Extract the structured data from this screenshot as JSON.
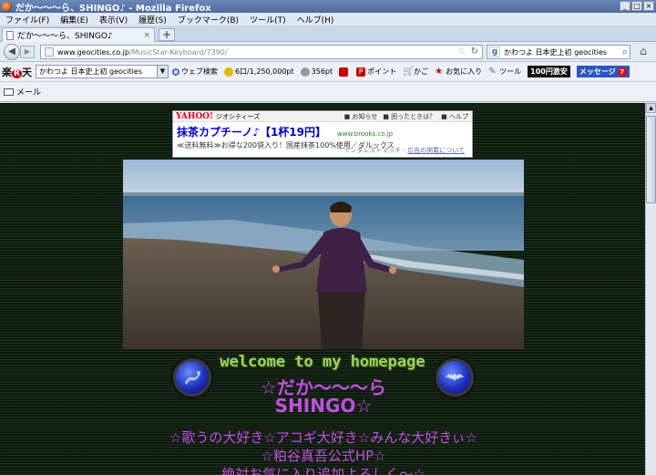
{
  "window": {
    "title": "だか～～～ら、SHINGO♪ - Mozilla Firefox",
    "controls": [
      "_",
      "□",
      "×"
    ]
  },
  "menu": [
    "ファイル(F)",
    "編集(E)",
    "表示(V)",
    "履歴(S)",
    "ブックマーク(B)",
    "ツール(T)",
    "ヘルプ(H)"
  ],
  "tab": {
    "label": "だか～～～ら、SHINGO♪",
    "close": "×",
    "new": "+"
  },
  "nav": {
    "back": "◀",
    "forward": "▶",
    "url_host": "www.geocities.co.jp",
    "url_path": "/MusicStar-Keyboard/7390/",
    "search_value": "かわつよ 日本史上初 geocities",
    "search_engine_icon": "google-g-icon",
    "home": "⌂"
  },
  "rakuten_bar": {
    "logo_text": "楽",
    "logo_r": "R",
    "logo_text2": "天",
    "search_value": "かわつよ 日本史上初 geocities",
    "items": [
      {
        "label": "ウェブ検索",
        "icon": "magnifier-icon"
      },
      {
        "label": "6口/1,250,000pt",
        "icon": "coin-icon"
      },
      {
        "label": "356pt",
        "icon": "points-icon"
      },
      {
        "label": "",
        "icon": "rakuten-card-icon"
      },
      {
        "label": "ポイント",
        "icon": "p-icon"
      },
      {
        "label": "かご",
        "icon": "cart-icon"
      },
      {
        "label": "お気に入り",
        "icon": "star-icon"
      },
      {
        "label": "ツール",
        "icon": "wrench-icon"
      }
    ],
    "sale_badge": "100円激安",
    "message_badge": "メッセージ",
    "message_count": "7"
  },
  "mail_bar": {
    "label": "メール"
  },
  "ad": {
    "brand": "YAHOO!",
    "brand_sub": "ジオシティーズ",
    "links": [
      "■ お知らせ",
      "■ 困ったときは？",
      "■ ヘルプ"
    ],
    "title": "抹茶カプチーノ♪【1杯19円】",
    "domain": "www.brooks.co.jp",
    "text": "≪送料無料≫お得な200袋入り！国産抹茶100%使用／ダルックス",
    "footer_prefix": "インタレストマッチ - ",
    "footer_link": "広告の掲載について"
  },
  "page": {
    "welcome": "welcome to my homepage",
    "name_line1": "☆だか～～～ら",
    "name_line2": "SHINGO☆",
    "line1": "☆歌うの大好き☆アコギ大好き☆みんな大好きぃ☆",
    "line2": "☆粕谷真吾公式HP☆",
    "line3": "絶対お気に入り追加よろしく～☆"
  },
  "colors": {
    "page_bg": "#0d1a0d",
    "welcome_green": "#9bd45a",
    "text_purple": "#c04fe0",
    "orb_blue": "#1b2fb8"
  }
}
